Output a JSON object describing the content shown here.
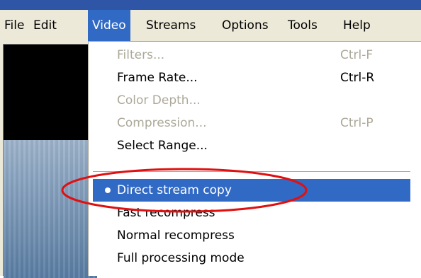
{
  "menubar": {
    "items": [
      "File",
      "Edit",
      "Video",
      "Streams",
      "Options",
      "Tools",
      "Help"
    ],
    "active_index": 2
  },
  "video_menu": {
    "items": [
      {
        "label": "Filters...",
        "shortcut": "Ctrl-F",
        "enabled": false
      },
      {
        "label": "Frame Rate...",
        "shortcut": "Ctrl-R",
        "enabled": true
      },
      {
        "label": "Color Depth...",
        "shortcut": "",
        "enabled": false
      },
      {
        "label": "Compression...",
        "shortcut": "Ctrl-P",
        "enabled": false
      },
      {
        "label": "Select Range...",
        "shortcut": "",
        "enabled": true,
        "underline": "R"
      }
    ],
    "mode_items": [
      {
        "label": "Direct stream copy",
        "selected": true
      },
      {
        "label": "Fast recompress",
        "selected": false
      },
      {
        "label": "Normal recompress",
        "selected": false
      },
      {
        "label": "Full processing mode",
        "selected": false
      }
    ]
  },
  "colors": {
    "menubar_bg": "#ece9d8",
    "highlight": "#316ac5",
    "disabled_text": "#aca899",
    "annotation": "#e01010"
  }
}
